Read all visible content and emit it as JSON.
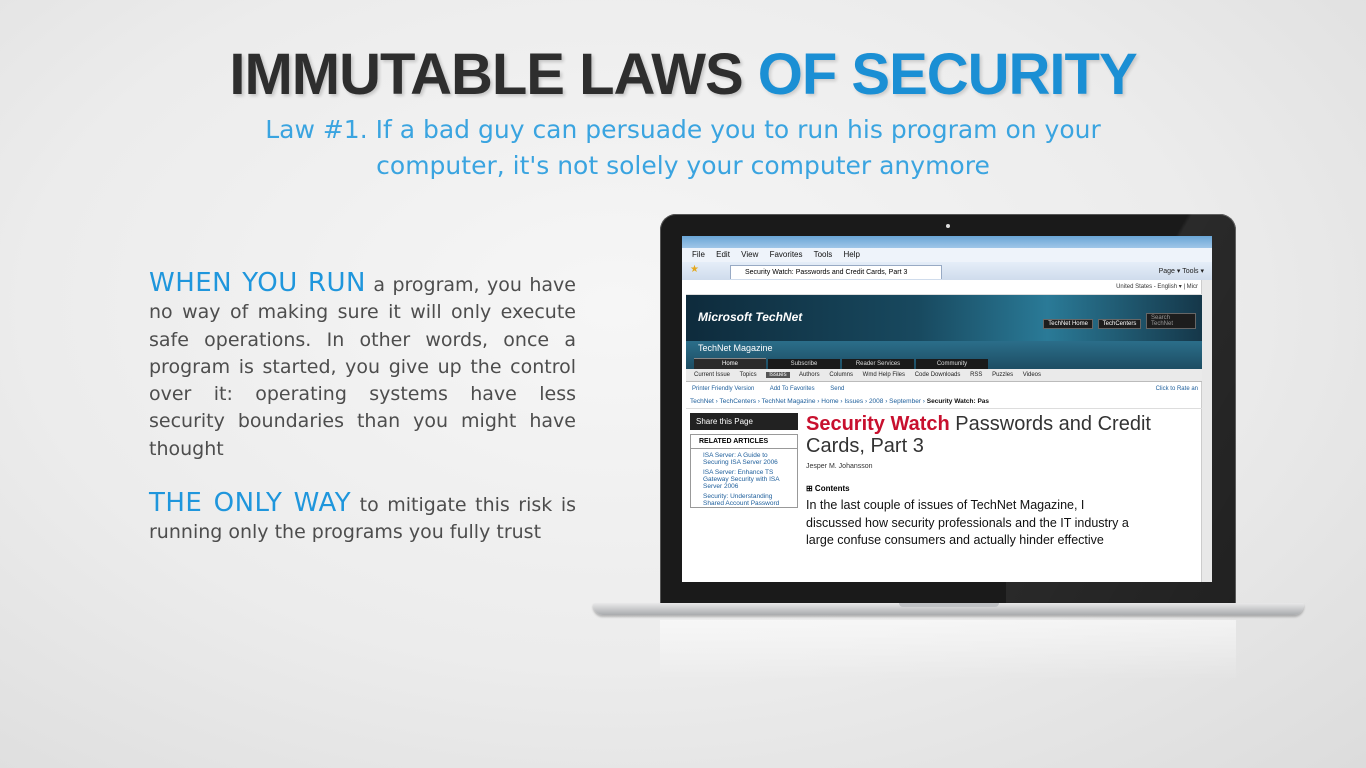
{
  "title": {
    "part1": "IMMUTABLE LAWS ",
    "part2": "OF SECURITY"
  },
  "subtitle": "Law #1. If a bad guy can persuade you to run his program on your computer, it's not solely your computer anymore",
  "paragraph1": {
    "lead": "WHEN YOU RUN",
    "text": " a program, you have no way of making sure it will only execute safe operations. In other words, once a program is started, you give up the control over it: operating systems have less security boundaries than you might have thought"
  },
  "paragraph2": {
    "lead": "THE ONLY WAY",
    "text": " to mitigate this risk is running only the programs you fully trust"
  },
  "browser": {
    "menu": [
      "File",
      "Edit",
      "View",
      "Favorites",
      "Tools",
      "Help"
    ],
    "tab_title": "Security Watch: Passwords and Credit Cards, Part 3",
    "tools": "Page ▾  Tools ▾",
    "top_strip": "United States - English ▾   |   Micr",
    "logo": "Microsoft TechNet",
    "banner_buttons": [
      "TechNet Home",
      "TechCenters"
    ],
    "search_placeholder": "Search TechNet",
    "magazine_label": "TechNet Magazine",
    "magazine_tabs": [
      "Home",
      "Subscribe",
      "Reader Services",
      "Community"
    ],
    "subnav": [
      "Current Issue",
      "Topics",
      "Issues",
      "Authors",
      "Columns",
      "Wmd Help Files",
      "Code Downloads",
      "RSS",
      "Puzzles",
      "Videos"
    ],
    "tool_links": [
      "Printer Friendly Version",
      "Add To Favorites",
      "Send"
    ],
    "rate_link": "Click to Rate an",
    "crumbs": "TechNet  ›  TechCenters  ›  TechNet Magazine  ›  Home  ›  Issues  ›  2008  ›  September  ›",
    "crumb_current": "Security Watch: Pas",
    "share": "Share this Page",
    "related_heading": "RELATED ARTICLES",
    "related": [
      "ISA Server: A Guide to Securing ISA Server 2006",
      "ISA Server: Enhance TS Gateway Security with ISA Server 2006",
      "Security: Understanding Shared Account Password"
    ],
    "article_title_red": "Security Watch",
    "article_title_rest": " Passwords and Credit Cards, Part 3",
    "author": "Jesper M. Johansson",
    "contents": "⊞ Contents",
    "body_lines": [
      "In the last couple of issues of TechNet Magazine, I",
      "discussed how security professionals and the IT industry a",
      "large confuse consumers and actually hinder effective"
    ]
  }
}
